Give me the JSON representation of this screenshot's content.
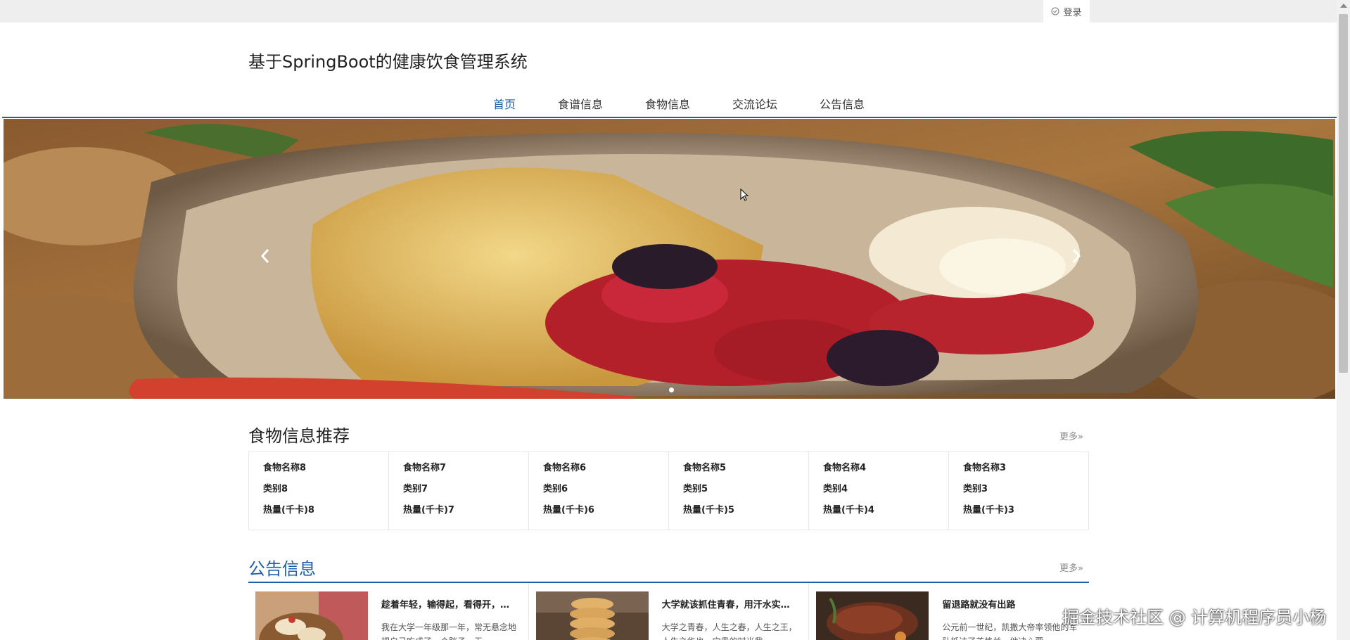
{
  "topbar": {
    "login_label": "登录"
  },
  "header": {
    "site_title": "基于SpringBoot的健康饮食管理系统",
    "nav": [
      "首页",
      "食谱信息",
      "食物信息",
      "交流论坛",
      "公告信息"
    ]
  },
  "food_section": {
    "title": "食物信息推荐",
    "more": "更多»",
    "items": [
      {
        "name": "食物名称8",
        "category": "类别8",
        "calories": "热量(千卡)8"
      },
      {
        "name": "食物名称7",
        "category": "类别7",
        "calories": "热量(千卡)7"
      },
      {
        "name": "食物名称6",
        "category": "类别6",
        "calories": "热量(千卡)6"
      },
      {
        "name": "食物名称5",
        "category": "类别5",
        "calories": "热量(千卡)5"
      },
      {
        "name": "食物名称4",
        "category": "类别4",
        "calories": "热量(千卡)4"
      },
      {
        "name": "食物名称3",
        "category": "类别3",
        "calories": "热量(千卡)3"
      }
    ]
  },
  "notice_section": {
    "title": "公告信息",
    "more": "更多»",
    "items": [
      {
        "title": "趁着年轻，输得起，看得开，…",
        "body": "我在大学一年级那一年，常无悬念地把自己吃成了一个胖子。无"
      },
      {
        "title": "大学就该抓住青春，用汗水实…",
        "body": "大学之青春，人生之春，人生之王，人生之华也。宝贵的时光我"
      },
      {
        "title": "留退路就没有出路",
        "body": "公元前一世纪，凯撒大帝率领他的军队抵达了英格兰，他决心要"
      }
    ]
  },
  "watermark": "掘金技术社区 @ 计算机程序员小杨",
  "colors": {
    "accent": "#1f5fa8",
    "topbar": "#eeeeee"
  }
}
